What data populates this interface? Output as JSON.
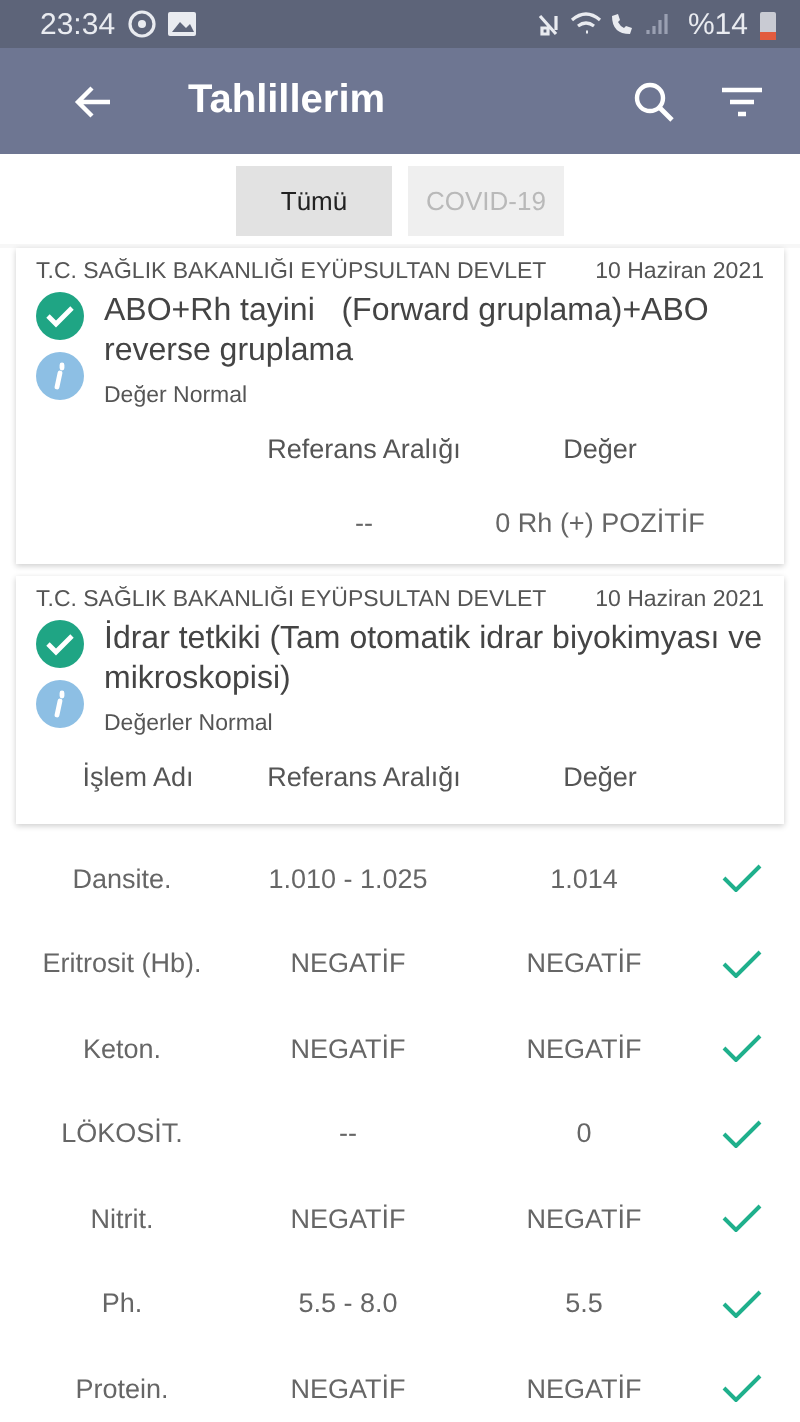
{
  "status_bar": {
    "time": "23:34",
    "battery": "%14"
  },
  "app_bar": {
    "title": "Tahlillerim"
  },
  "tabs": [
    {
      "label": "Tümü",
      "selected": true
    },
    {
      "label": "COVID-19",
      "selected": false
    }
  ],
  "results": [
    {
      "hospital": "T.C. SAĞLIK BAKANLIĞI EYÜPSULTAN DEVLET",
      "date": "10 Haziran 2021",
      "title": "ABO+Rh tayini   (Forward gruplama)+ABO reverse gruplama",
      "ok": true,
      "summary": "Değer Normal",
      "columns": [
        "",
        "Referans Aralığı",
        "Değer"
      ],
      "rows": [
        {
          "name": "",
          "range": "--",
          "value": "0 Rh (+) POZİTİF",
          "ok": false
        }
      ]
    },
    {
      "hospital": "T.C. SAĞLIK BAKANLIĞI EYÜPSULTAN DEVLET",
      "date": "10 Haziran 2021",
      "title": "İdrar tetkiki (Tam otomatik idrar biyokimyası ve mikroskopisi)",
      "ok": true,
      "summary": "Değerler Normal",
      "columns": [
        "İşlem Adı",
        "Referans Aralığı",
        "Değer"
      ],
      "rows": [
        {
          "name": "Dansite.",
          "range": "1.010 - 1.025",
          "value": "1.014",
          "ok": true
        },
        {
          "name": "Eritrosit (Hb).",
          "range": "NEGATİF",
          "value": "NEGATİF",
          "ok": true
        },
        {
          "name": "Keton.",
          "range": "NEGATİF",
          "value": "NEGATİF",
          "ok": true
        },
        {
          "name": "LÖKOSİT.",
          "range": "--",
          "value": "0",
          "ok": true
        },
        {
          "name": "Nitrit.",
          "range": "NEGATİF",
          "value": "NEGATİF",
          "ok": true
        },
        {
          "name": "Ph.",
          "range": "5.5 - 8.0",
          "value": "5.5",
          "ok": true
        },
        {
          "name": "Protein.",
          "range": "NEGATİF",
          "value": "NEGATİF",
          "ok": true
        }
      ]
    }
  ]
}
